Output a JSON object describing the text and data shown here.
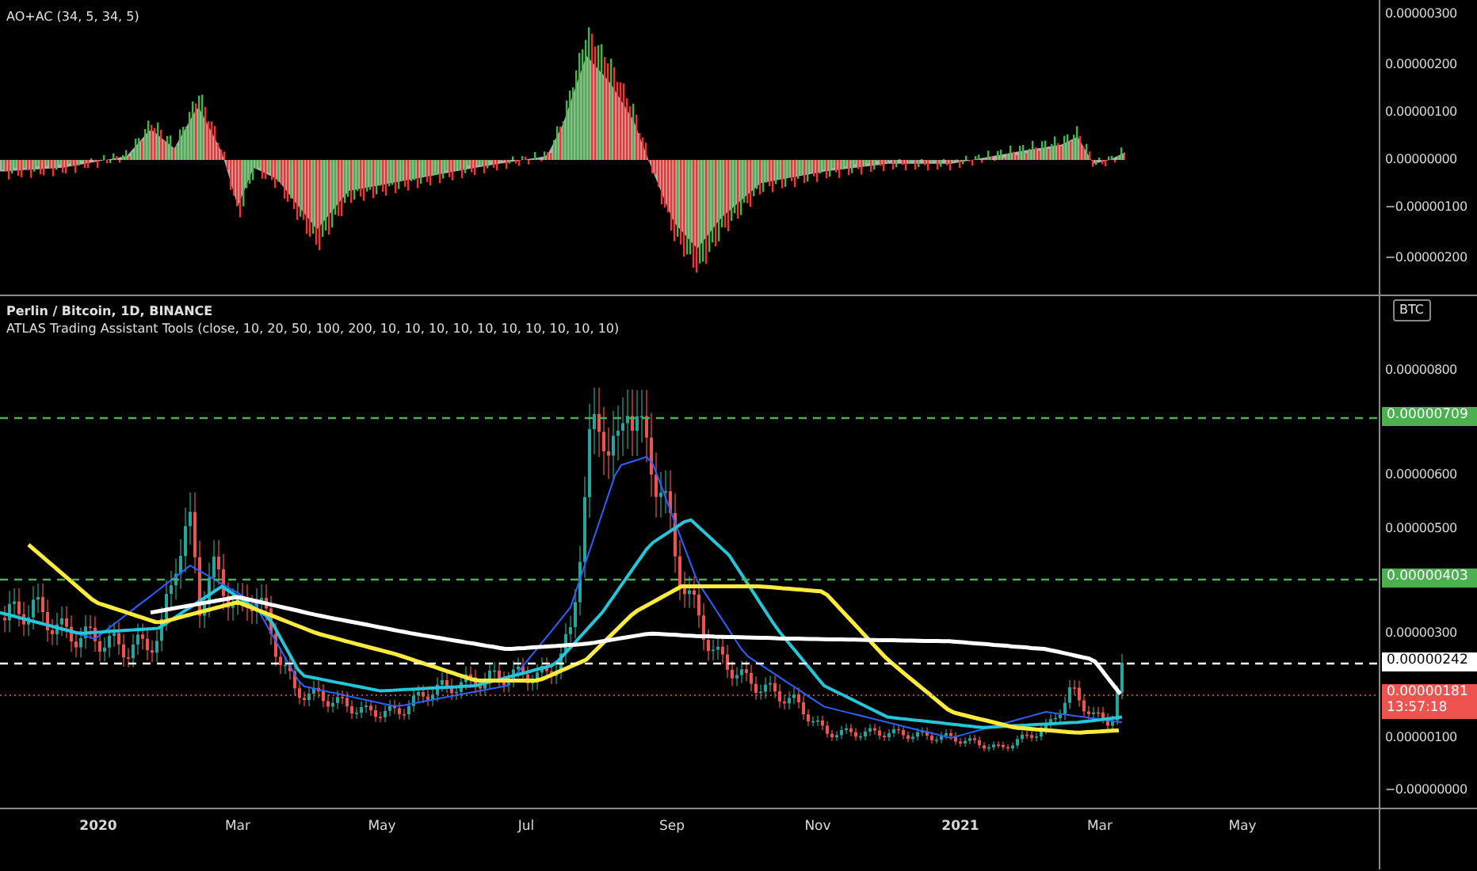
{
  "indicator_pane": {
    "legend": "AO+AC (34, 5, 34, 5)",
    "axis_labels": [
      "0.00000300",
      "0.00000200",
      "0.00000100",
      "0.00000000",
      "−0.00000100",
      "−0.00000200"
    ]
  },
  "price_pane": {
    "symbol": "Perlin / Bitcoin, 1D, BINANCE",
    "study": "ATLAS Trading Assistant Tools (close, 10, 20, 50, 100, 200, 10, 10, 10, 10, 10, 10, 10, 10, 10, 10)",
    "currency": "BTC",
    "axis_labels": [
      "0.00000800",
      "0.00000600",
      "0.00000500",
      "0.00000300",
      "0.00000100",
      "−0.00000000"
    ],
    "price_labels": [
      {
        "kind": "level",
        "text": "0.00000709"
      },
      {
        "kind": "level",
        "text": "0.00000403"
      },
      {
        "kind": "average",
        "text": "0.00000242"
      },
      {
        "kind": "last",
        "text": "0.00000181",
        "countdown": "13:57:18"
      }
    ]
  },
  "time_axis": [
    {
      "text": "2020",
      "kind": "year"
    },
    {
      "text": "Mar",
      "kind": "month"
    },
    {
      "text": "May",
      "kind": "month"
    },
    {
      "text": "Jul",
      "kind": "month"
    },
    {
      "text": "Sep",
      "kind": "month"
    },
    {
      "text": "Nov",
      "kind": "month"
    },
    {
      "text": "2021",
      "kind": "year"
    },
    {
      "text": "Mar",
      "kind": "month"
    },
    {
      "text": "May",
      "kind": "month"
    }
  ]
}
